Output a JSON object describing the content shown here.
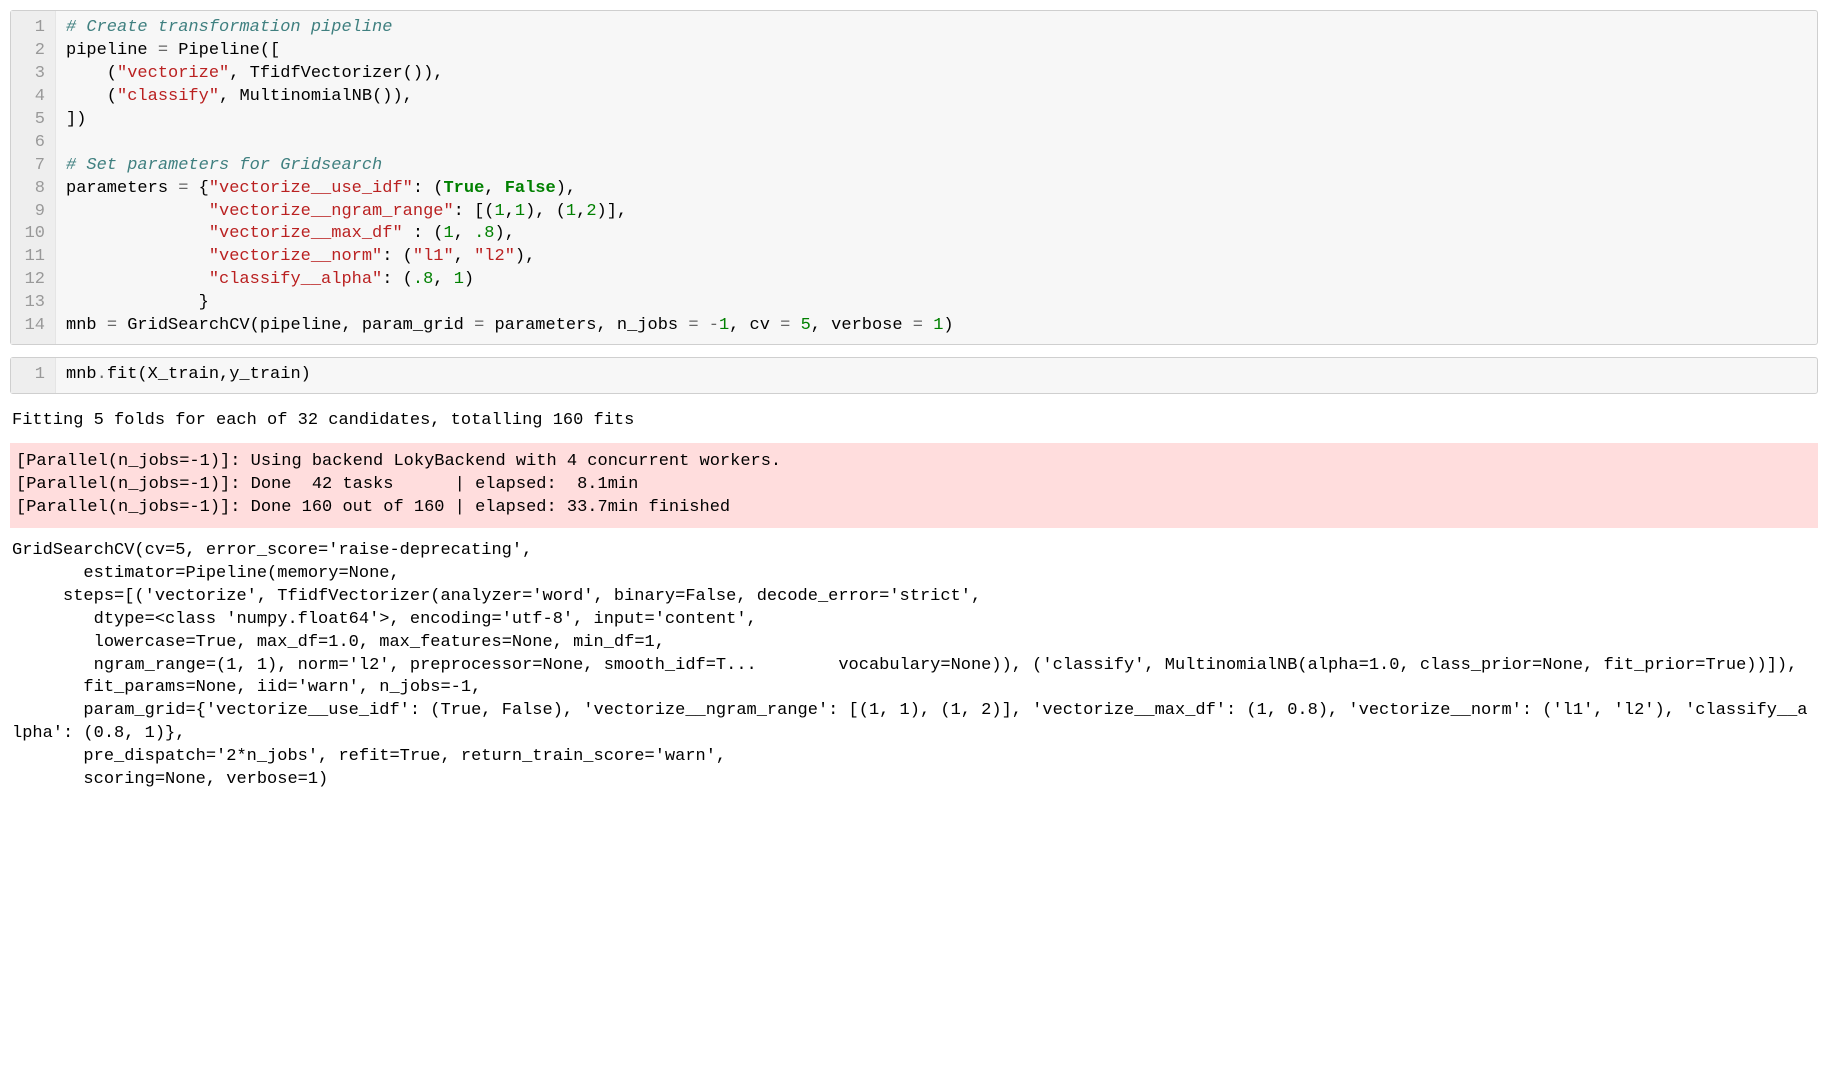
{
  "cell1": {
    "line_numbers": [
      "1",
      "2",
      "3",
      "4",
      "5",
      "6",
      "7",
      "8",
      "9",
      "10",
      "11",
      "12",
      "13",
      "14"
    ],
    "l1_comment": "# Create transformation pipeline",
    "l2_a": "pipeline ",
    "l2_op": "=",
    "l2_b": " Pipeline([",
    "l3_a": "    (",
    "l3_s": "\"vectorize\"",
    "l3_b": ", TfidfVectorizer()),",
    "l4_a": "    (",
    "l4_s": "\"classify\"",
    "l4_b": ", MultinomialNB()),",
    "l5": "])",
    "l6": "",
    "l7_comment": "# Set parameters for Gridsearch",
    "l8_a": "parameters ",
    "l8_op": "=",
    "l8_b": " {",
    "l8_s": "\"vectorize__use_idf\"",
    "l8_c": ": (",
    "l8_kw1": "True",
    "l8_d": ", ",
    "l8_kw2": "False",
    "l8_e": "),",
    "l9_pad": "              ",
    "l9_s": "\"vectorize__ngram_range\"",
    "l9_a": ": [(",
    "l9_n1": "1",
    "l9_b": ",",
    "l9_n2": "1",
    "l9_c": "), (",
    "l9_n3": "1",
    "l9_d": ",",
    "l9_n4": "2",
    "l9_e": ")],",
    "l10_pad": "              ",
    "l10_s": "\"vectorize__max_df\"",
    "l10_a": " : (",
    "l10_n1": "1",
    "l10_b": ", ",
    "l10_n2": ".8",
    "l10_c": "),",
    "l11_pad": "              ",
    "l11_s": "\"vectorize__norm\"",
    "l11_a": ": (",
    "l11_s2": "\"l1\"",
    "l11_b": ", ",
    "l11_s3": "\"l2\"",
    "l11_c": "),",
    "l12_pad": "              ",
    "l12_s": "\"classify__alpha\"",
    "l12_a": ": (",
    "l12_n1": ".8",
    "l12_b": ", ",
    "l12_n2": "1",
    "l12_c": ")",
    "l13_pad": "             }",
    "l14_a": "mnb ",
    "l14_op": "=",
    "l14_b": " GridSearchCV(pipeline, param_grid ",
    "l14_op2": "=",
    "l14_c": " parameters, n_jobs ",
    "l14_op3": "=",
    "l14_d": " ",
    "l14_op4": "-",
    "l14_n1": "1",
    "l14_e": ", cv ",
    "l14_op5": "=",
    "l14_f": " ",
    "l14_n2": "5",
    "l14_g": ", verbose ",
    "l14_op6": "=",
    "l14_h": " ",
    "l14_n3": "1",
    "l14_i": ")"
  },
  "cell2": {
    "line_numbers": [
      "1"
    ],
    "l1_a": "mnb",
    "l1_b": ".",
    "l1_c": "fit(X_train,y_train)"
  },
  "stdout_line": "Fitting 5 folds for each of 32 candidates, totalling 160 fits",
  "stderr_text": "[Parallel(n_jobs=-1)]: Using backend LokyBackend with 4 concurrent workers.\n[Parallel(n_jobs=-1)]: Done  42 tasks      | elapsed:  8.1min\n[Parallel(n_jobs=-1)]: Done 160 out of 160 | elapsed: 33.7min finished",
  "result_text": "GridSearchCV(cv=5, error_score='raise-deprecating',\n       estimator=Pipeline(memory=None,\n     steps=[('vectorize', TfidfVectorizer(analyzer='word', binary=False, decode_error='strict',\n        dtype=<class 'numpy.float64'>, encoding='utf-8', input='content',\n        lowercase=True, max_df=1.0, max_features=None, min_df=1,\n        ngram_range=(1, 1), norm='l2', preprocessor=None, smooth_idf=T...        vocabulary=None)), ('classify', MultinomialNB(alpha=1.0, class_prior=None, fit_prior=True))]),\n       fit_params=None, iid='warn', n_jobs=-1,\n       param_grid={'vectorize__use_idf': (True, False), 'vectorize__ngram_range': [(1, 1), (1, 2)], 'vectorize__max_df': (1, 0.8), 'vectorize__norm': ('l1', 'l2'), 'classify__alpha': (0.8, 1)},\n       pre_dispatch='2*n_jobs', refit=True, return_train_score='warn',\n       scoring=None, verbose=1)"
}
